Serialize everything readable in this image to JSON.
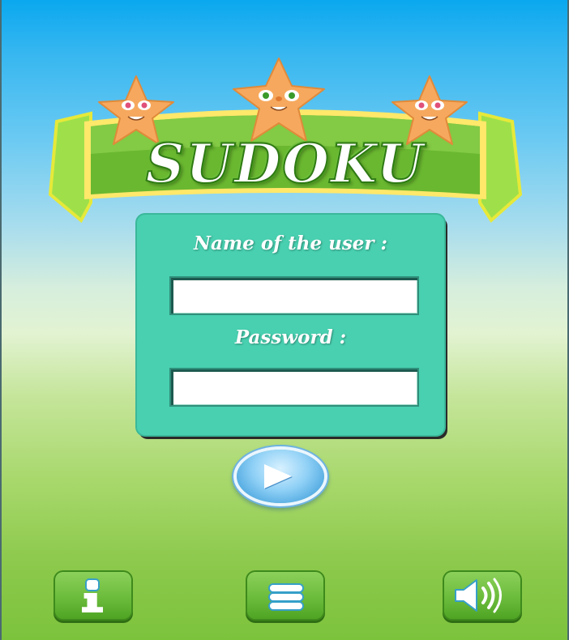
{
  "app": {
    "logo_text": "SUDOKU"
  },
  "login": {
    "username_label": "Name of the user :",
    "username_value": "",
    "password_label": "Password :",
    "password_value": ""
  },
  "buttons": {
    "play_icon": "play-icon",
    "info_icon": "info-icon",
    "menu_icon": "menu-icon",
    "sound_icon": "speaker-icon"
  },
  "colors": {
    "panel": "#48d0b0",
    "button_green": "#6cbc3c",
    "sky_top": "#0aa8ef",
    "grass_bottom": "#7cc33c",
    "star": "#f6a95e"
  }
}
